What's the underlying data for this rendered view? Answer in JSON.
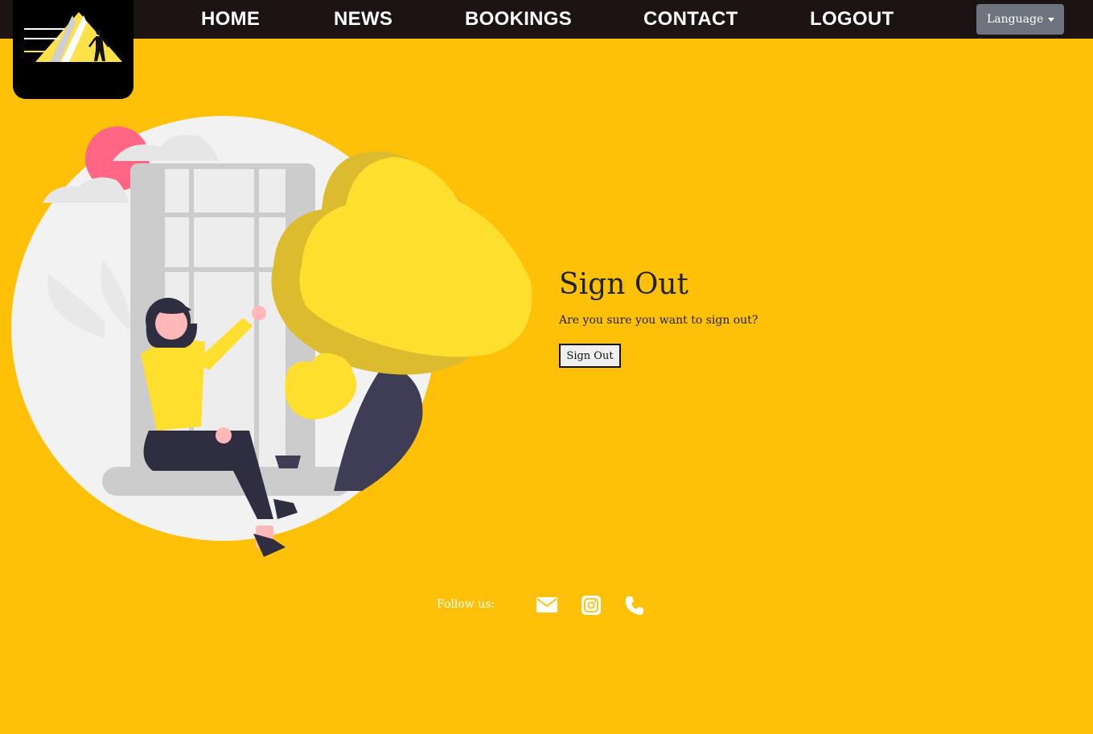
{
  "nav": {
    "items": [
      {
        "label": "HOME"
      },
      {
        "label": "NEWS"
      },
      {
        "label": "BOOKINGS"
      },
      {
        "label": "CONTACT"
      },
      {
        "label": "LOGOUT"
      }
    ],
    "language_label": "Language"
  },
  "main": {
    "title": "Sign Out",
    "message": "Are you sure you want to sign out?",
    "button_label": "Sign Out"
  },
  "footer": {
    "follow_label": "Follow us:",
    "icons": [
      "envelope-icon",
      "instagram-icon",
      "phone-icon"
    ]
  },
  "colors": {
    "background": "#FFC107",
    "navbar": "#1c1414",
    "language_button": "#6c757d"
  }
}
